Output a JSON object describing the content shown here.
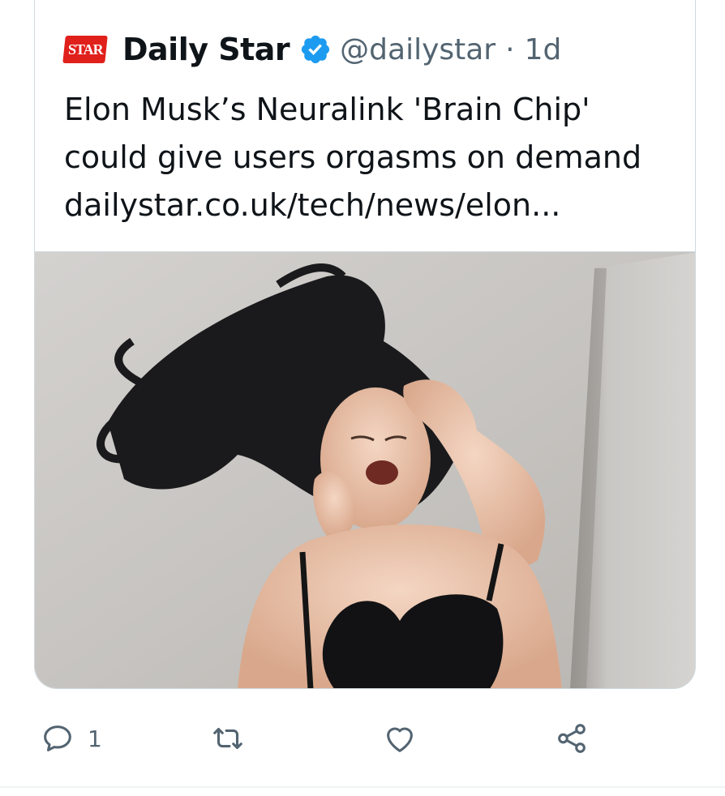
{
  "tweet": {
    "logo_text": "STAR",
    "author_name": "Daily Star",
    "handle": "@dailystar",
    "separator": "·",
    "time": "1d",
    "text_lines": [
      "Elon Musk’s Neuralink 'Brain Chip'",
      "could give users orgasms on demand",
      "dailystar.co.uk/tech/news/elon..."
    ]
  },
  "actions": {
    "reply_count": "1"
  },
  "colors": {
    "brand_red": "#e0201b",
    "verified_blue": "#1d9bf0",
    "secondary_text": "#536471",
    "border": "#cfd9de"
  },
  "icons": [
    "verified-icon",
    "reply-icon",
    "retweet-icon",
    "like-icon",
    "share-icon"
  ]
}
